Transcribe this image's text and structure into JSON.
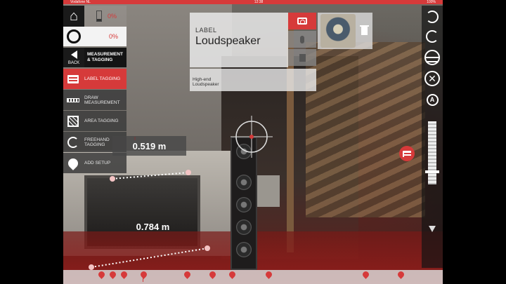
{
  "status_bar": {
    "carrier": "Vodafone NL",
    "time": "12:38",
    "battery": "100%"
  },
  "toolbar": {
    "battery_pct": "0%",
    "progress_pct": "0%",
    "back_label": "BACK",
    "section_title": "MEASUREMENT & TAGGING",
    "menu": [
      {
        "label": "LABEL TAGGING",
        "icon": "label-tag-icon",
        "active": true
      },
      {
        "label": "DRAW MEASUREMENT",
        "icon": "ruler-icon",
        "active": false
      },
      {
        "label": "AREA TAGGING",
        "icon": "area-icon",
        "active": false
      },
      {
        "label": "FREEHAND TAGGING",
        "icon": "freehand-icon",
        "active": false
      },
      {
        "label": "ADD SETUP",
        "icon": "pin-icon",
        "active": false
      }
    ]
  },
  "label_panel": {
    "heading": "LABEL",
    "name": "Loudspeaker",
    "description": "High-end Loudspeaker"
  },
  "measurements": [
    {
      "value": "0.519 m"
    },
    {
      "value": "0.784 m"
    }
  ],
  "right_tools": [
    "undo-icon",
    "redo-icon",
    "sphere-icon",
    "cross-icon",
    "zoom-icon"
  ],
  "colors": {
    "accent": "#d63a3a",
    "panel": "#e8e8e8"
  }
}
